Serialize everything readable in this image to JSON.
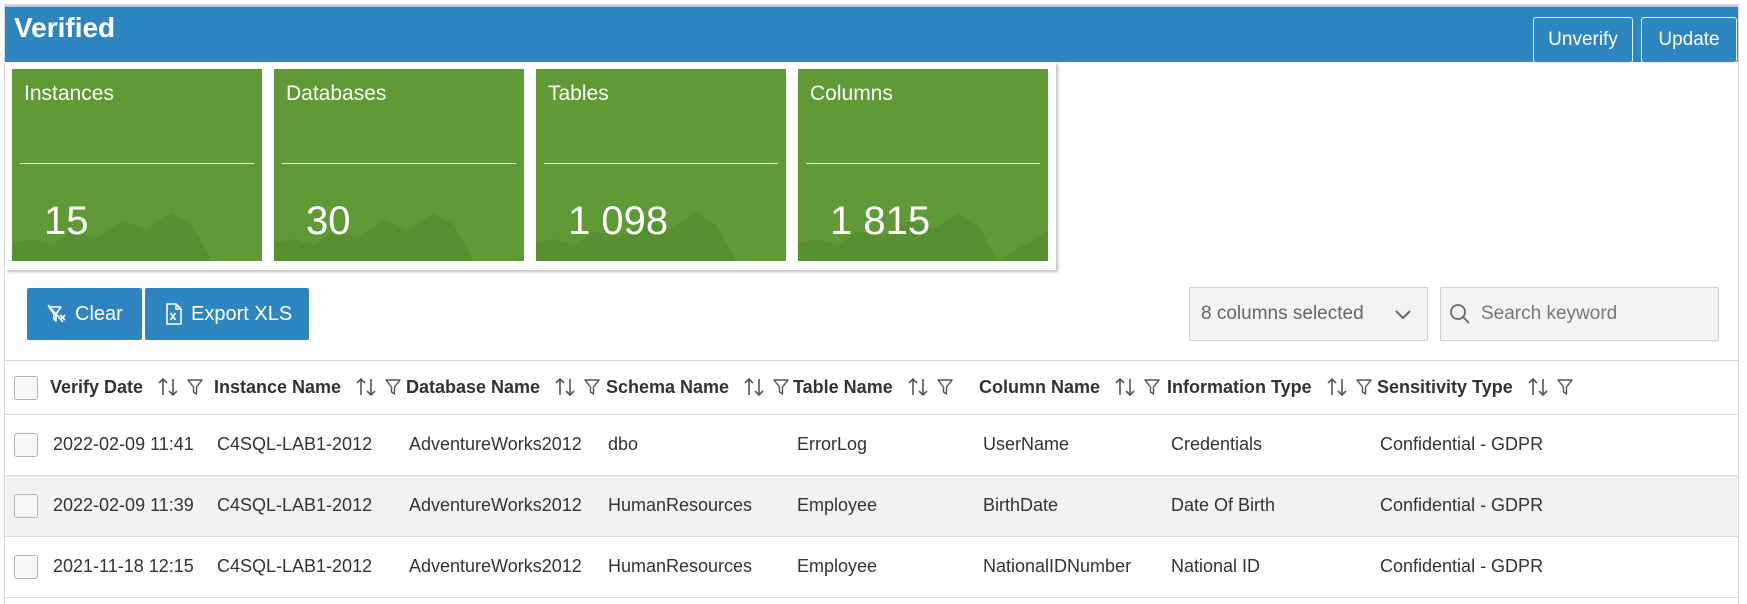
{
  "header": {
    "title": "Verified",
    "unverify_label": "Unverify",
    "update_label": "Update"
  },
  "cards": [
    {
      "label": "Instances",
      "value": "15"
    },
    {
      "label": "Databases",
      "value": "30"
    },
    {
      "label": "Tables",
      "value": "1 098"
    },
    {
      "label": "Columns",
      "value": "1 815"
    }
  ],
  "toolbar": {
    "clear_label": "Clear",
    "export_label": "Export XLS",
    "columns_selected": "8 columns selected",
    "search_placeholder": "Search keyword"
  },
  "table": {
    "columns": [
      "Verify Date",
      "Instance Name",
      "Database Name",
      "Schema Name",
      "Table Name",
      "Column Name",
      "Information Type",
      "Sensitivity Type"
    ],
    "rows": [
      [
        "2022-02-09 11:41",
        "C4SQL-LAB1-2012",
        "AdventureWorks2012",
        "dbo",
        "ErrorLog",
        "UserName",
        "Credentials",
        "Confidential - GDPR"
      ],
      [
        "2022-02-09 11:39",
        "C4SQL-LAB1-2012",
        "AdventureWorks2012",
        "HumanResources",
        "Employee",
        "BirthDate",
        "Date Of Birth",
        "Confidential - GDPR"
      ],
      [
        "2021-11-18 12:15",
        "C4SQL-LAB1-2012",
        "AdventureWorks2012",
        "HumanResources",
        "Employee",
        "NationalIDNumber",
        "National ID",
        "Confidential - GDPR"
      ]
    ]
  },
  "colors": {
    "header_blue": "#2e86c1",
    "card_green": "#5f9a36"
  },
  "icons": [
    "filter-clear-icon",
    "excel-file-icon",
    "chevron-down-icon",
    "search-icon",
    "sort-icon",
    "filter-icon"
  ]
}
